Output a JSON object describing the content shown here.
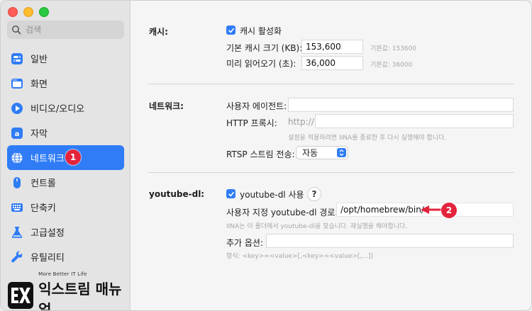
{
  "sidebar": {
    "search_placeholder": "검색",
    "items": [
      {
        "label": "일반",
        "icon": "toggle-switches-icon"
      },
      {
        "label": "화면",
        "icon": "window-screen-icon"
      },
      {
        "label": "비디오/오디오",
        "icon": "play-circle-icon"
      },
      {
        "label": "자막",
        "icon": "subtitle-icon"
      },
      {
        "label": "네트워크",
        "icon": "globe-icon",
        "active": true
      },
      {
        "label": "컨트롤",
        "icon": "mouse-icon"
      },
      {
        "label": "단축키",
        "icon": "keyboard-icon"
      },
      {
        "label": "고급설정",
        "icon": "flask-icon"
      },
      {
        "label": "유틸리티",
        "icon": "wrench-icon"
      }
    ],
    "badge_1": "1"
  },
  "logo": {
    "tagline": "More Better IT Life",
    "brand": "익스트림 매뉴얼"
  },
  "cache": {
    "section_label": "캐시:",
    "enable_label": "캐시 활성화",
    "enable_checked": true,
    "size_label": "기본 캐시 크기 (KB):",
    "size_value": "153,600",
    "size_default": "기본값: 153600",
    "readahead_label": "미리 읽어오기 (초):",
    "readahead_value": "36,000",
    "readahead_default": "기본값: 36000"
  },
  "network": {
    "section_label": "네트워크:",
    "user_agent_label": "사용자 에이전트:",
    "user_agent_value": "",
    "proxy_label": "HTTP 프록시:",
    "proxy_prefix": "http://",
    "proxy_value": "",
    "proxy_hint": "설정을 적용하려면 IINA를 종료한 후 다시 실행해야 합니다.",
    "rtsp_label": "RTSP 스트림 전송:",
    "rtsp_value": "자동"
  },
  "ytdl": {
    "section_label": "youtube-dl:",
    "enable_label": "youtube-dl 사용",
    "enable_checked": true,
    "help_label": "?",
    "path_label": "사용자 지정 youtube-dl 경로:",
    "path_value": "/opt/homebrew/bin/",
    "path_hint": "IINA는 이 폴더에서 youtube-dl을 찾습니다. 재실행을 해야합니다.",
    "options_label": "추가 옵션:",
    "options_value": "",
    "options_hint": "형식: <key>=<value>[,<key>=<value>[,...]]"
  },
  "annotation": {
    "badge_2": "2"
  },
  "colors": {
    "accent": "#2f7cf6",
    "badge": "#e3243b"
  }
}
